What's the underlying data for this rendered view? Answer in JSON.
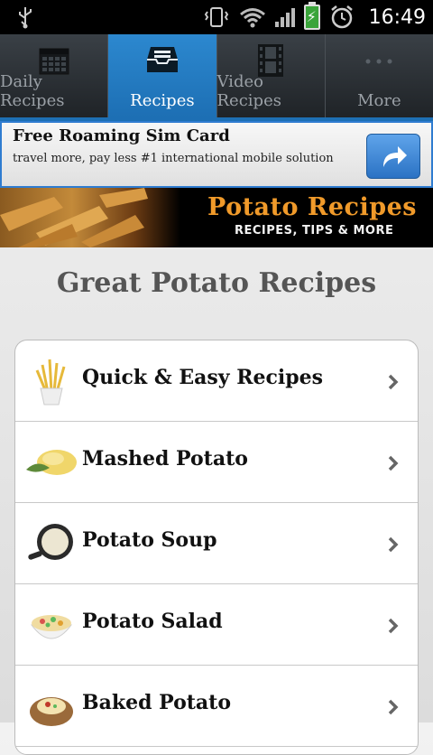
{
  "status": {
    "time": "16:49"
  },
  "tabs": [
    {
      "label": "Daily Recipes",
      "active": false,
      "icon": "calendar-icon"
    },
    {
      "label": "Recipes",
      "active": true,
      "icon": "inbox-icon"
    },
    {
      "label": "Video Recipes",
      "active": false,
      "icon": "film-icon"
    },
    {
      "label": "More",
      "active": false,
      "icon": "more-icon"
    }
  ],
  "ad": {
    "title": "Free Roaming Sim Card",
    "text": "travel more, pay less #1 international mobile solution",
    "button_icon": "share-arrow-icon"
  },
  "banner": {
    "title": "Potato Recipes",
    "subtitle": "RECIPES, TIPS & MORE"
  },
  "page_title": "Great Potato Recipes",
  "list": [
    {
      "label": "Quick & Easy Recipes",
      "icon": "fries-icon"
    },
    {
      "label": "Mashed Potato",
      "icon": "mashed-potato-icon"
    },
    {
      "label": "Potato Soup",
      "icon": "soup-bowl-icon"
    },
    {
      "label": "Potato Salad",
      "icon": "salad-bowl-icon"
    },
    {
      "label": "Baked Potato",
      "icon": "baked-potato-icon"
    }
  ],
  "colors": {
    "accent": "#1d6fb4",
    "banner_orange": "#f09a2a"
  }
}
